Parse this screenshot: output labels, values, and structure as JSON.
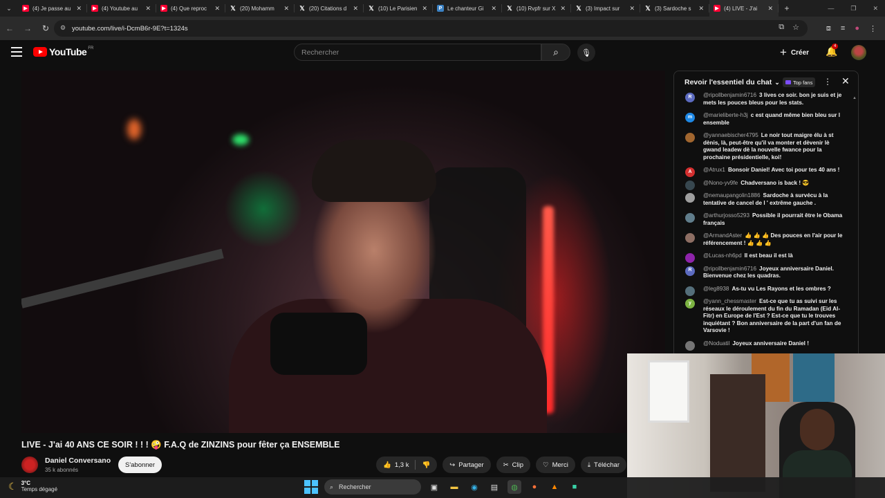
{
  "browser": {
    "tabs": [
      {
        "label": "(4) Je passe au",
        "icon": "youtube-icon",
        "kind": "yt"
      },
      {
        "label": "(4) Youtube au",
        "icon": "youtube-icon",
        "kind": "yt"
      },
      {
        "label": "(4) Que reproc",
        "icon": "youtube-icon",
        "kind": "yt"
      },
      {
        "label": "(20) Mohamm",
        "icon": "x-icon",
        "kind": "x"
      },
      {
        "label": "(20) Citations d",
        "icon": "x-icon",
        "kind": "x"
      },
      {
        "label": "(10) Le Parisien",
        "icon": "x-icon",
        "kind": "x"
      },
      {
        "label": "Le chanteur Gi",
        "icon": "page-icon",
        "kind": "p"
      },
      {
        "label": "(10) Rvpfr sur X",
        "icon": "x-icon",
        "kind": "x"
      },
      {
        "label": "(3) Impact sur",
        "icon": "x-icon",
        "kind": "x"
      },
      {
        "label": "(3) Sardoche s",
        "icon": "x-icon",
        "kind": "x"
      },
      {
        "label": "(4) LIVE - J'ai",
        "icon": "youtube-icon",
        "kind": "yt",
        "active": true
      }
    ],
    "url": "youtube.com/live/i-DcmB6r-9E?t=1324s"
  },
  "youtube": {
    "logo_text": "YouTube",
    "logo_country": "FR",
    "search_placeholder": "Rechercher",
    "create_label": "Créer",
    "notification_count": "4"
  },
  "video": {
    "title": "LIVE - J'ai 40 ANS CE SOIR ! ! ! 🤪 F.A.Q de ZINZINS pour fêter ça ENSEMBLE",
    "channel_name": "Daniel Conversano",
    "subscribers": "35 k abonnés",
    "subscribe_label": "S'abonner",
    "likes": "1,3 k",
    "share_label": "Partager",
    "clip_label": "Clip",
    "thanks_label": "Merci",
    "download_label": "Téléchar"
  },
  "chat": {
    "header": "Revoir l'essentiel du chat",
    "top_fans": "Top fans",
    "messages": [
      {
        "author": "@ripollbenjamin6716",
        "text": "3 lives ce soir. bon je suis et je mets les pouces bleus pour les stats.",
        "initial": "R",
        "color": "#5c6bc0"
      },
      {
        "author": "@marieliberte-h3j",
        "text": "c est quand même bien bleu sur l ensemble",
        "initial": "m",
        "color": "#1e88e5"
      },
      {
        "author": "@yannaebischer4795",
        "text": "Le noir tout maigre élu à st dènis, là, peut-être qu'il va monter et dèvenir lè gwand leadew dè la nouvelle fwance pour la prochaine présidentielle, koi!",
        "initial": "",
        "color": "#a1662f"
      },
      {
        "author": "@Atrux1",
        "text": "Bonsoir Daniel! Avec toi pour tes 40 ans !",
        "initial": "A",
        "color": "#d32f2f"
      },
      {
        "author": "@Nono-yv9fe",
        "text": "Chadversano is back ! 😎",
        "initial": "",
        "color": "#37474f"
      },
      {
        "author": "@nemaupangolin1886",
        "text": "Sardoche à survécu à la tentative de cancel de l ' extrême gauche .",
        "initial": "",
        "color": "#9e9e9e"
      },
      {
        "author": "@arthurjosso5293",
        "text": "Possible il pourrait être le Obama français",
        "initial": "",
        "color": "#607d8b"
      },
      {
        "author": "@ArmandAster",
        "text": "👍 👍 👍 Des pouces en l'air pour le référencement ! 👍 👍 👍",
        "initial": "",
        "color": "#8d6e63"
      },
      {
        "author": "@Lucas-nh6pd",
        "text": "Il est beau il est là",
        "initial": "",
        "color": "#8e24aa"
      },
      {
        "author": "@ripollbenjamin6716",
        "text": "Joyeux anniversaire Daniel. Bienvenue chez les quadras.",
        "initial": "R",
        "color": "#5c6bc0"
      },
      {
        "author": "@leg8938",
        "text": "As-tu vu Les Rayons et les ombres ?",
        "initial": "",
        "color": "#546e7a"
      },
      {
        "author": "@yann_chessmaster",
        "text": "Est-ce que tu as suivi sur les réseaux le déroulement du fin du Ramadan (Eid Al-Fitr) en Europe de l'Est ? Est-ce que tu le trouves inquiétant ? Bon anniversaire de la part d'un fan de Varsovie !",
        "initial": "y",
        "color": "#7cb342"
      },
      {
        "author": "@Noduatil",
        "text": "Joyeux anniversaire Daniel !",
        "initial": "",
        "color": "#757575"
      }
    ]
  },
  "taskbar": {
    "temperature": "3°C",
    "weather": "Temps dégagé",
    "search_label": "Rechercher"
  }
}
